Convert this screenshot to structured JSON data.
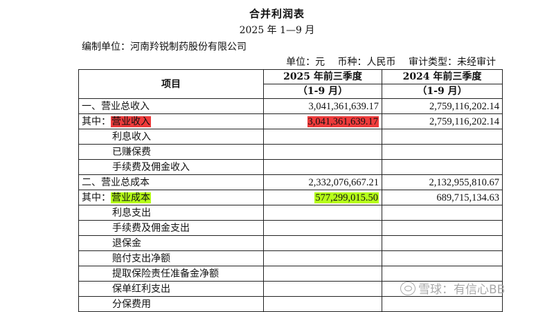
{
  "title": "合并利润表",
  "period": "2025 年 1—9 月",
  "org_line": "编制单位：河南羚锐制药股份有限公司",
  "meta": {
    "unit": "单位：元",
    "currency": "币种：人民币",
    "audit": "审计类型：未经审计"
  },
  "table": {
    "header_item": "项目",
    "header_col2_line1": "2025 年前三季度",
    "header_col2_line2": "（1-9 月）",
    "header_col3_line1": "2024 年前三季度",
    "header_col3_line2": "（1-9 月）",
    "rows": [
      {
        "name": "一、营业总收入",
        "v2025": "3,041,361,639.17",
        "v2024": "2,759,116,202.14"
      },
      {
        "prefix": "其中：",
        "name": "营业收入",
        "v2025": "3,041,361,639.17",
        "v2024": "2,759,116,202.14",
        "highlight": "#ee3b3b"
      },
      {
        "name": "利息收入",
        "v2025": "",
        "v2024": ""
      },
      {
        "name": "已赚保费",
        "v2025": "",
        "v2024": ""
      },
      {
        "name": "手续费及佣金收入",
        "v2025": "",
        "v2024": ""
      },
      {
        "name": "二、营业总成本",
        "v2025": "2,332,076,667.21",
        "v2024": "2,132,955,810.67"
      },
      {
        "prefix": "其中：",
        "name": "营业成本",
        "v2025": "577,299,015.50",
        "v2024": "689,715,134.63",
        "highlight": "#b6ff1a"
      },
      {
        "name": "利息支出",
        "v2025": "",
        "v2024": ""
      },
      {
        "name": "手续费及佣金支出",
        "v2025": "",
        "v2024": ""
      },
      {
        "name": "退保金",
        "v2025": "",
        "v2024": ""
      },
      {
        "name": "赔付支出净额",
        "v2025": "",
        "v2024": ""
      },
      {
        "name": "提取保险责任准备金净额",
        "v2025": "",
        "v2024": ""
      },
      {
        "name": "保单红利支出",
        "v2025": "",
        "v2024": ""
      },
      {
        "name": "分保费用",
        "v2025": "",
        "v2024": ""
      }
    ]
  },
  "watermark": {
    "icon": "wechat-icon",
    "text": "雪球：有信心BB"
  }
}
